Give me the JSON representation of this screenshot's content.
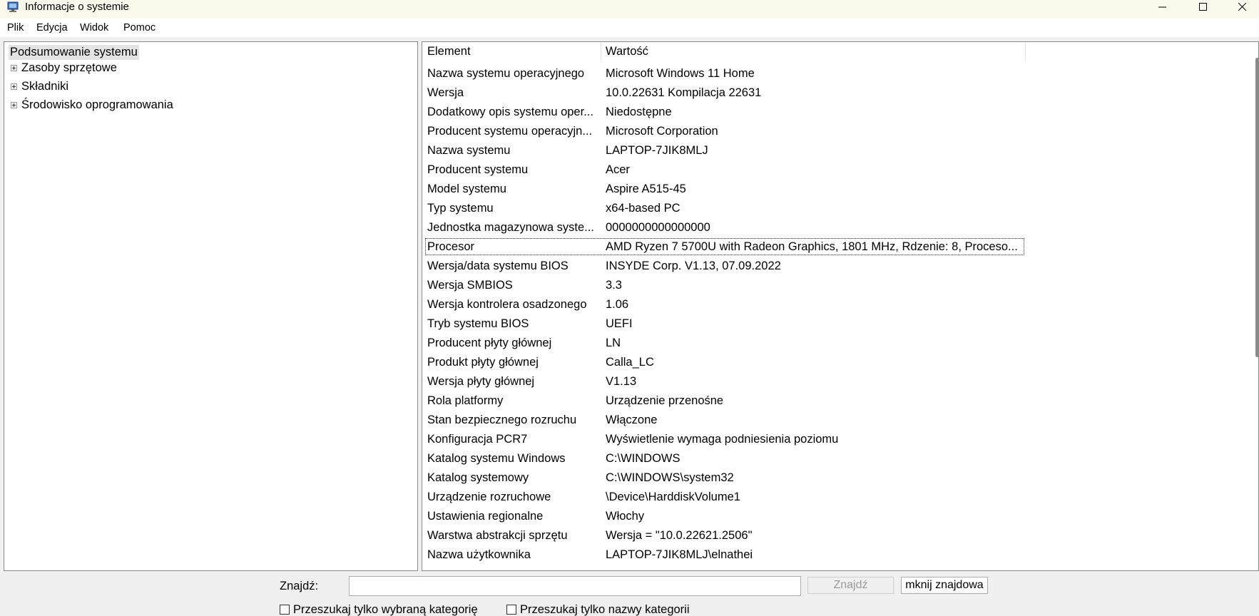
{
  "window": {
    "title": "Informacje o systemie",
    "icon": "system-info-icon"
  },
  "menu": [
    "Plik",
    "Edycja",
    "Widok",
    "Pomoc"
  ],
  "tree": {
    "root": "Podsumowanie systemu",
    "children": [
      "Zasoby sprzętowe",
      "Składniki",
      "Środowisko oprogramowania"
    ]
  },
  "list": {
    "headers": [
      "Element",
      "Wartość"
    ],
    "rows": [
      {
        "element": "Nazwa systemu operacyjnego",
        "value": "Microsoft Windows 11 Home"
      },
      {
        "element": "Wersja",
        "value": "10.0.22631 Kompilacja 22631"
      },
      {
        "element": "Dodatkowy opis systemu oper...",
        "value": "Niedostępne"
      },
      {
        "element": "Producent systemu operacyjn...",
        "value": "Microsoft Corporation"
      },
      {
        "element": "Nazwa systemu",
        "value": "LAPTOP-7JIK8MLJ"
      },
      {
        "element": "Producent systemu",
        "value": "Acer"
      },
      {
        "element": "Model systemu",
        "value": "Aspire A515-45"
      },
      {
        "element": "Typ systemu",
        "value": "x64-based PC"
      },
      {
        "element": "Jednostka magazynowa syste...",
        "value": "0000000000000000"
      },
      {
        "element": "Procesor",
        "value": "AMD Ryzen 7 5700U with Radeon Graphics, 1801 MHz, Rdzenie: 8, Proceso..."
      },
      {
        "element": "Wersja/data systemu BIOS",
        "value": "INSYDE Corp. V1.13, 07.09.2022"
      },
      {
        "element": "Wersja SMBIOS",
        "value": "3.3"
      },
      {
        "element": "Wersja kontrolera osadzonego",
        "value": "1.06"
      },
      {
        "element": "Tryb systemu BIOS",
        "value": "UEFI"
      },
      {
        "element": "Producent płyty głównej",
        "value": "LN"
      },
      {
        "element": "Produkt płyty głównej",
        "value": "Calla_LC"
      },
      {
        "element": "Wersja płyty głównej",
        "value": "V1.13"
      },
      {
        "element": "Rola platformy",
        "value": "Urządzenie przenośne"
      },
      {
        "element": "Stan bezpiecznego rozruchu",
        "value": "Włączone"
      },
      {
        "element": "Konfiguracja PCR7",
        "value": "Wyświetlenie wymaga podniesienia poziomu"
      },
      {
        "element": "Katalog systemu Windows",
        "value": "C:\\WINDOWS"
      },
      {
        "element": "Katalog systemowy",
        "value": "C:\\WINDOWS\\system32"
      },
      {
        "element": "Urządzenie rozruchowe",
        "value": "\\Device\\HarddiskVolume1"
      },
      {
        "element": "Ustawienia regionalne",
        "value": "Włochy"
      },
      {
        "element": "Warstwa abstrakcji sprzętu",
        "value": "Wersja = \"10.0.22621.2506\""
      },
      {
        "element": "Nazwa użytkownika",
        "value": "LAPTOP-7JIK8MLJ\\elnathei"
      }
    ]
  },
  "find": {
    "label": "Znajdź:",
    "value": "",
    "find_button": "Znajdź",
    "close_button": "mknij znajdowa",
    "checkbox_selected_category": "Przeszukaj tylko wybraną kategorię",
    "checkbox_category_names": "Przeszukaj tylko nazwy kategorii"
  }
}
